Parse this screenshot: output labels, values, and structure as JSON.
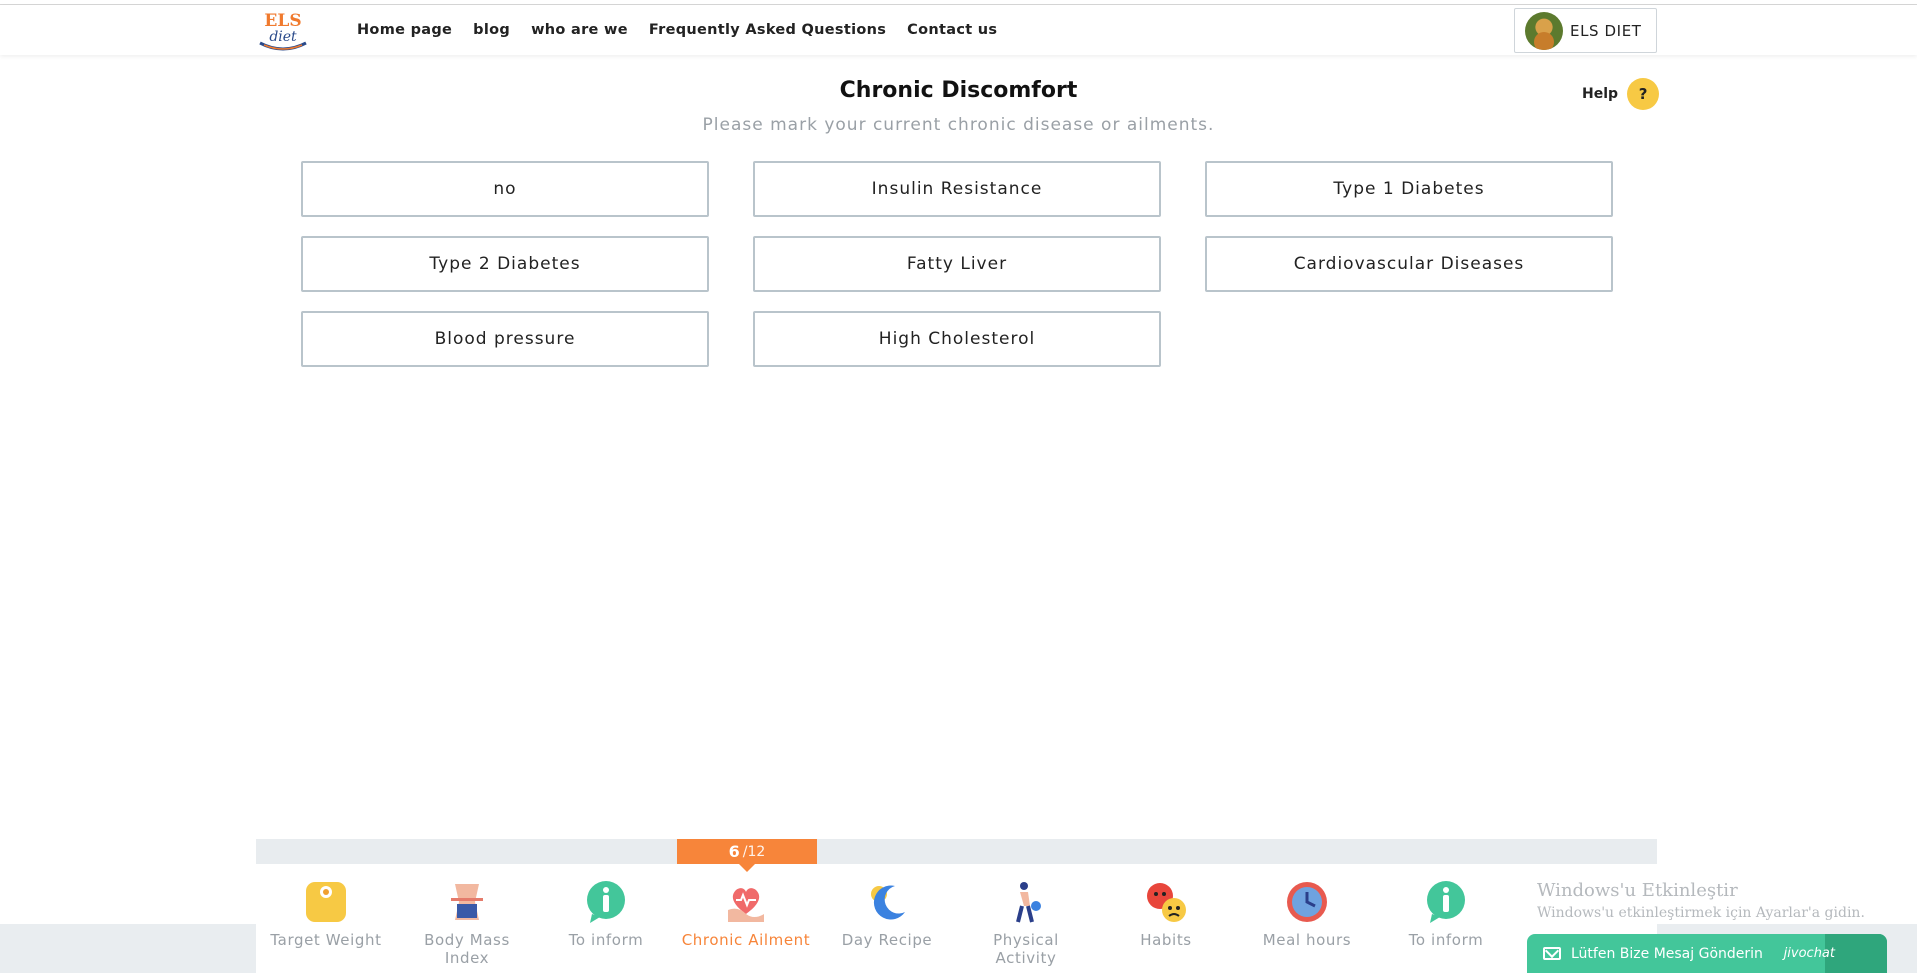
{
  "header": {
    "logo_text_top": "ELS",
    "logo_text_bottom": "diet",
    "nav": [
      "Home page",
      "blog",
      "who are we",
      "Frequently Asked Questions",
      "Contact us"
    ],
    "user_name": "ELS DIET"
  },
  "main": {
    "title": "Chronic Discomfort",
    "subtitle": "Please mark your current chronic disease or ailments.",
    "help_label": "Help",
    "help_icon": "?",
    "options": [
      "no",
      "Insulin Resistance",
      "Type 1 Diabetes",
      "Type 2 Diabetes",
      "Fatty Liver",
      "Cardiovascular Diseases",
      "Blood pressure",
      "High Cholesterol"
    ]
  },
  "progress": {
    "current": "6",
    "total": "/12"
  },
  "steps": [
    {
      "label": "Target Weight",
      "icon": "scale-icon",
      "color": "#f7c944"
    },
    {
      "label": "Body Mass Index",
      "icon": "body-icon",
      "color": "#e57b6b"
    },
    {
      "label": "To inform",
      "icon": "info-icon",
      "color": "#43c69a"
    },
    {
      "label": "Chronic Ailment",
      "icon": "heart-hand-icon",
      "color": "#f06a6a",
      "active": true
    },
    {
      "label": "Day Recipe",
      "icon": "moon-sun-icon",
      "color": "#3b82e0"
    },
    {
      "label": "Physical Activity",
      "icon": "runner-icon",
      "color": "#2b3f8a"
    },
    {
      "label": "Habits",
      "icon": "faces-icon",
      "color": "#e8463b"
    },
    {
      "label": "Meal hours",
      "icon": "clock-icon",
      "color": "#e85a4f"
    },
    {
      "label": "To inform",
      "icon": "info-icon",
      "color": "#43c69a"
    }
  ],
  "windows_notice": {
    "line1": "Windows'u Etkinleştir",
    "line2": "Windows'u etkinleştirmek için Ayarlar'a gidin."
  },
  "chat": {
    "label": "Lütfen Bize Mesaj Gönderin",
    "brand": "jivochat"
  }
}
